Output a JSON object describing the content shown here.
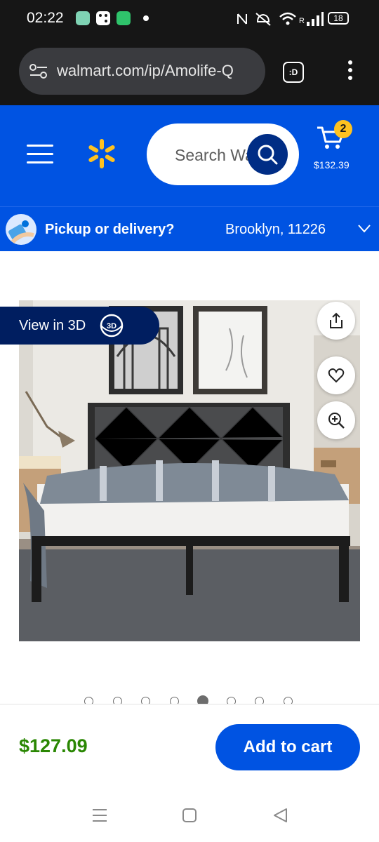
{
  "status_bar": {
    "time": "02:22",
    "battery": "18",
    "network": "R",
    "icons": [
      "nfc-icon",
      "mute-icon",
      "wifi-icon",
      "signal-icon"
    ]
  },
  "browser": {
    "url": "walmart.com/ip/Amolife-Q",
    "tabs_label": ":D"
  },
  "header": {
    "search_placeholder": "Search Walmart",
    "cart_count": "2",
    "cart_total": "$132.39",
    "brand_color": "#0053e2",
    "spark_color": "#ffc220"
  },
  "pickup": {
    "title": "Pickup or delivery?",
    "location": "Brooklyn, 11226"
  },
  "product": {
    "view_3d_label": "View in 3D",
    "badge_3d": "3D",
    "carousel": {
      "total": 8,
      "active_index": 4
    }
  },
  "buy_bar": {
    "price": "$127.09",
    "add_to_cart_label": "Add to cart",
    "price_color": "#2a8703"
  }
}
